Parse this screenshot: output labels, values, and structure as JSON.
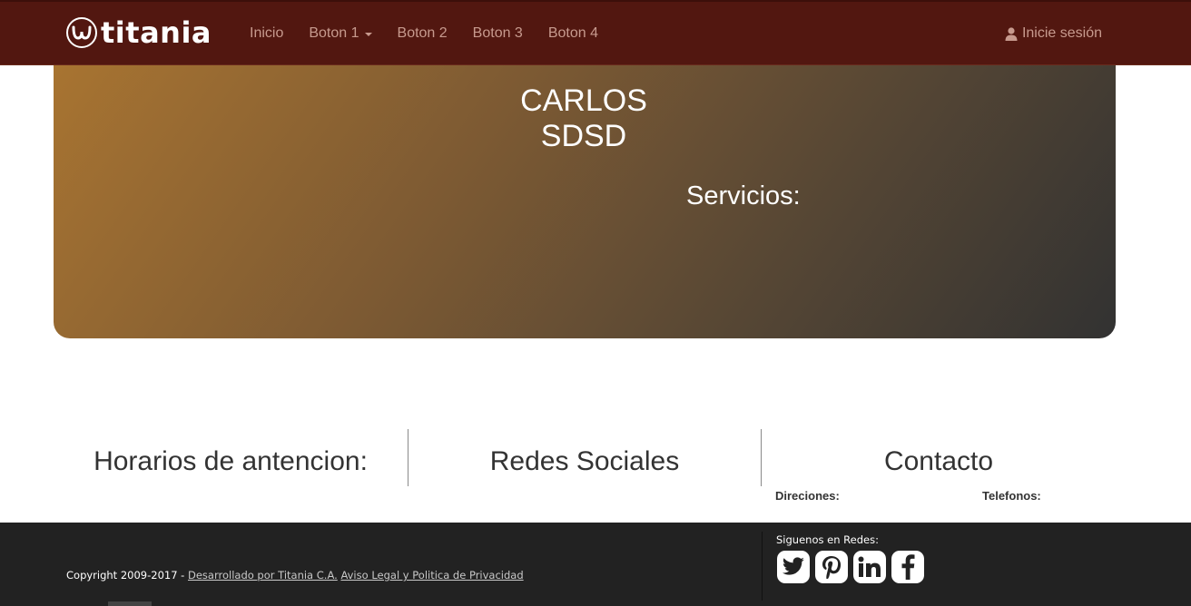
{
  "brand": {
    "name": "titania",
    "logo_icon": "titania-logo-icon"
  },
  "nav": {
    "items": [
      {
        "label": "Inicio"
      },
      {
        "label": "Boton 1",
        "has_caret": true
      },
      {
        "label": "Boton 2"
      },
      {
        "label": "Boton 3"
      },
      {
        "label": "Boton 4"
      }
    ],
    "login_label": "Inicie sesión",
    "login_icon": "user-icon"
  },
  "hero": {
    "name_line1": "CARLOS",
    "name_line2": "SDSD",
    "services_label": "Servicios:"
  },
  "info": {
    "hours_title": "Horarios de antencion:",
    "social_title": "Redes Sociales",
    "contact_title": "Contacto",
    "addresses_label": "Direciones:",
    "phones_label": "Telefonos:"
  },
  "footer": {
    "copyright_text": "Copyright 2009-2017 - ",
    "developed_link": "Desarrollado por Titania C.A.",
    "legal_link": "Aviso Legal y Politica de Privacidad",
    "follow_label": "Siguenos en Redes:",
    "social_icons": [
      "twitter-icon",
      "pinterest-icon",
      "linkedin-icon",
      "facebook-icon"
    ]
  },
  "colors": {
    "navbar_bg": "#521710",
    "nav_text": "#c79a8e",
    "hero_gradient_start": "#a87431",
    "hero_gradient_end": "#323232",
    "footer_bg": "#222222"
  }
}
